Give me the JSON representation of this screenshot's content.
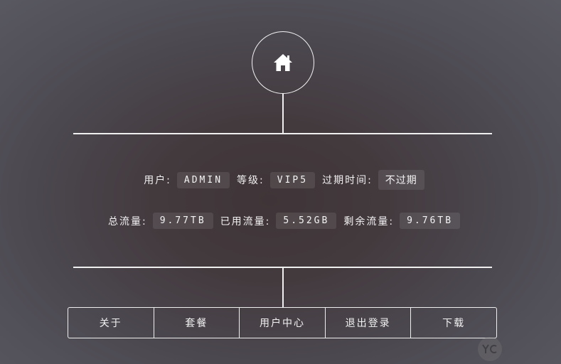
{
  "header": {
    "home_icon": "home-icon"
  },
  "user_info": {
    "user_label": "用户:",
    "user_value": "ADMIN",
    "level_label": "等级:",
    "level_value": "VIP5",
    "expiry_label": "过期时间:",
    "expiry_value": "不过期"
  },
  "traffic_info": {
    "total_label": "总流量:",
    "total_value": "9.77TB",
    "used_label": "已用流量:",
    "used_value": "5.52GB",
    "remaining_label": "剩余流量:",
    "remaining_value": "9.76TB"
  },
  "nav": {
    "items": [
      {
        "label": "关于"
      },
      {
        "label": "套餐"
      },
      {
        "label": "用户中心"
      },
      {
        "label": "退出登录"
      },
      {
        "label": "下载"
      }
    ]
  },
  "watermark": {
    "logo_icon": "yc-logo-icon"
  },
  "colors": {
    "line": "#efefef",
    "value_bg": "rgba(255,255,255,0.09)"
  }
}
